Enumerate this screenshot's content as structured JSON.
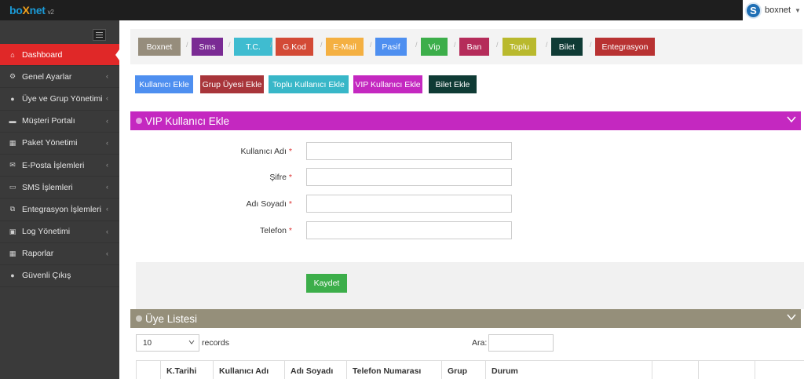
{
  "app": {
    "logo_prefix": "bo",
    "logo_x": "X",
    "logo_suffix": "net",
    "logo_version": "v2"
  },
  "user": {
    "avatar_letter": "S",
    "name": "boxnet"
  },
  "sidebar": {
    "items": [
      {
        "label": "Dashboard",
        "icon": "home-icon",
        "glyph": "⌂",
        "active": true
      },
      {
        "label": "Genel Ayarlar",
        "icon": "gears-icon",
        "glyph": "⚙"
      },
      {
        "label": "Üye ve Grup Yönetimi",
        "icon": "user-icon",
        "glyph": "●"
      },
      {
        "label": "Müşteri Portalı",
        "icon": "folder-icon",
        "glyph": "▬"
      },
      {
        "label": "Paket Yönetimi",
        "icon": "table-icon",
        "glyph": "▦"
      },
      {
        "label": "E-Posta İşlemleri",
        "icon": "envelope-icon",
        "glyph": "✉"
      },
      {
        "label": "SMS İşlemleri",
        "icon": "comment-icon",
        "glyph": "▭"
      },
      {
        "label": "Entegrasyon İşlemleri",
        "icon": "sitemap-icon",
        "glyph": "⧉"
      },
      {
        "label": "Log Yönetimi",
        "icon": "briefcase-icon",
        "glyph": "▣"
      },
      {
        "label": "Raporlar",
        "icon": "grid-icon",
        "glyph": "▦"
      },
      {
        "label": "Güvenli Çıkış",
        "icon": "user-icon",
        "glyph": "●"
      }
    ]
  },
  "tags": [
    {
      "label": "Boxnet",
      "color": "#968d7c"
    },
    {
      "label": "Sms",
      "color": "#7a2b94"
    },
    {
      "label": "T.C.",
      "color": "#3fbcd0"
    },
    {
      "label": "G.Kod",
      "color": "#d34a36"
    },
    {
      "label": "E-Mail",
      "color": "#f4b042"
    },
    {
      "label": "Pasif",
      "color": "#4e8ff0"
    },
    {
      "label": "Vip",
      "color": "#3cae4a"
    },
    {
      "label": "Ban",
      "color": "#b52c5a"
    },
    {
      "label": "Toplu",
      "color": "#b9b92d"
    },
    {
      "label": "Bilet",
      "color": "#0f3b35"
    },
    {
      "label": "Entegrasyon",
      "color": "#b83232"
    }
  ],
  "tag_separator": "/",
  "actions": [
    {
      "label": "Kullanıcı Ekle",
      "color": "#4e8ff0"
    },
    {
      "label": "Grup Üyesi Ekle",
      "color": "#a8353a"
    },
    {
      "label": "Toplu Kullanıcı Ekle",
      "color": "#38b7c8"
    },
    {
      "label": "VIP Kullanıcı Ekle",
      "color": "#c428c0"
    },
    {
      "label": "Bilet Ekle",
      "color": "#0f3b35"
    }
  ],
  "vip_panel": {
    "title": "VIP Kullanıcı Ekle",
    "color": "#c428c0",
    "fields": [
      {
        "label": "Kullanıcı Adı",
        "value": ""
      },
      {
        "label": "Şifre",
        "value": ""
      },
      {
        "label": "Adı Soyadı",
        "value": ""
      },
      {
        "label": "Telefon",
        "value": ""
      }
    ],
    "required_mark": "*",
    "save_label": "Kaydet"
  },
  "list_panel": {
    "title": "Üye Listesi",
    "color": "#958f7a",
    "page_length": "10",
    "records_label": "records",
    "search_label": "Ara:",
    "search_value": "",
    "columns": [
      "",
      "K.Tarihi",
      "Kullanıcı Adı",
      "Adı Soyadı",
      "Telefon Numarası",
      "Grup",
      "Durum",
      "",
      "",
      ""
    ]
  }
}
